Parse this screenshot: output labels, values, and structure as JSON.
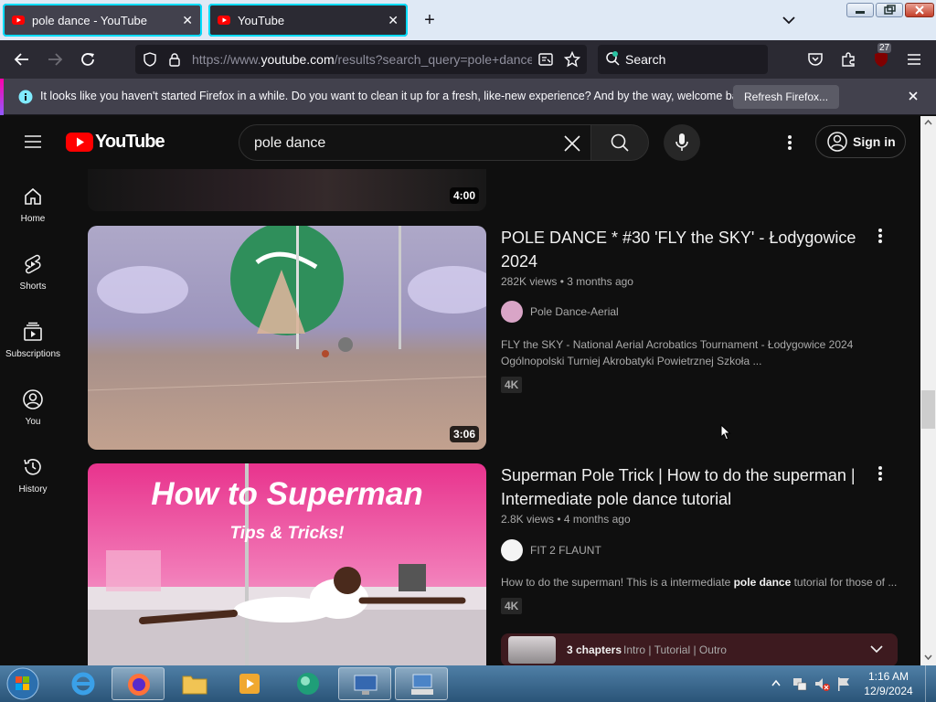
{
  "browser": {
    "tabs": [
      {
        "title": "pole dance - YouTube",
        "active": true
      },
      {
        "title": "YouTube",
        "active": false
      }
    ],
    "url_prefix": "https://www.",
    "url_domain": "youtube.com",
    "url_rest": "/results?search_query=pole+dance",
    "search_placeholder": "Search",
    "extension_badge": "27"
  },
  "notification": {
    "message": "It looks like you haven't started Firefox in a while. Do you want to clean it up for a fresh, like-new experience? And by the way, welcome back!",
    "button": "Refresh Firefox..."
  },
  "youtube": {
    "logo_text": "YouTube",
    "search_query": "pole dance",
    "signin_label": "Sign in",
    "sidebar": [
      {
        "label": "Home",
        "icon": "home-icon"
      },
      {
        "label": "Shorts",
        "icon": "shorts-icon"
      },
      {
        "label": "Subscriptions",
        "icon": "subscriptions-icon"
      },
      {
        "label": "You",
        "icon": "you-icon"
      },
      {
        "label": "History",
        "icon": "history-icon"
      }
    ],
    "videos": [
      {
        "duration": "4:00"
      },
      {
        "title": "POLE DANCE * #30 'FLY the SKY' - Łodygowice 2024",
        "views": "282K views",
        "age": "3 months ago",
        "channel": "Pole Dance-Aerial",
        "description_line1": "FLY the SKY - National Aerial Acrobatics Tournament - Łodygowice 2024",
        "description_line2": "Ogólnopolski Turniej Akrobatyki Powietrznej Szkoła ...",
        "badge": "4K",
        "duration": "3:06"
      },
      {
        "title": "Superman Pole Trick | How to do the superman | Intermediate pole dance tutorial",
        "views": "2.8K views",
        "age": "4 months ago",
        "channel": "FIT 2 FLAUNT",
        "description_before": "How to do the superman! This is a intermediate ",
        "description_bold": "pole dance",
        "description_after": " tutorial for those of ...",
        "badge": "4K",
        "thumb_title": "How to Superman",
        "thumb_sub": "Tips & Tricks!",
        "chapters_label": "3 chapters",
        "chapters_list": "Intro | Tutorial | Outro"
      }
    ]
  },
  "taskbar": {
    "time": "1:16 AM",
    "date": "12/9/2024"
  },
  "colors": {
    "yt_bg": "#0f0f0f",
    "yt_red": "#ff0000",
    "firefox_accent": "#00ddff",
    "chapters_bg": "#3d1a1f"
  }
}
